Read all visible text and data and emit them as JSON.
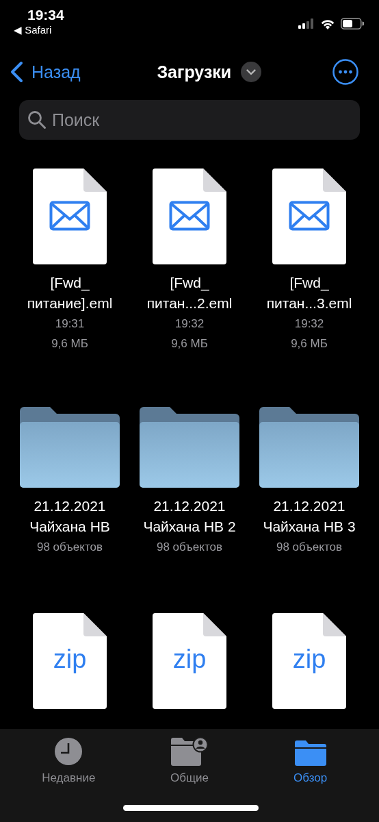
{
  "status_bar": {
    "time": "19:34",
    "back_app": "◀ Safari"
  },
  "nav": {
    "back": "Назад",
    "title": "Загрузки"
  },
  "search": {
    "placeholder": "Поиск"
  },
  "items": [
    {
      "kind": "eml",
      "name_lines": [
        "[Fwd_",
        "питание].eml"
      ],
      "details": [
        "19:31",
        "9,6 МБ"
      ]
    },
    {
      "kind": "eml",
      "name_lines": [
        "[Fwd_",
        "питан...2.eml"
      ],
      "details": [
        "19:32",
        "9,6 МБ"
      ]
    },
    {
      "kind": "eml",
      "name_lines": [
        "[Fwd_",
        "питан...3.eml"
      ],
      "details": [
        "19:32",
        "9,6 МБ"
      ]
    },
    {
      "kind": "folder",
      "name_lines": [
        "21.12.2021",
        "Чайхана НВ"
      ],
      "details": [
        "98 объектов"
      ]
    },
    {
      "kind": "folder",
      "name_lines": [
        "21.12.2021",
        "Чайхана НВ 2"
      ],
      "details": [
        "98 объектов"
      ]
    },
    {
      "kind": "folder",
      "name_lines": [
        "21.12.2021",
        "Чайхана НВ 3"
      ],
      "details": [
        "98 объектов"
      ]
    },
    {
      "kind": "zip",
      "badge": "zip"
    },
    {
      "kind": "zip",
      "badge": "zip"
    },
    {
      "kind": "zip",
      "badge": "zip"
    }
  ],
  "tabs": [
    {
      "kind": "recent",
      "label": "Недавние",
      "selected": false
    },
    {
      "kind": "shared",
      "label": "Общие",
      "selected": false
    },
    {
      "kind": "browse",
      "label": "Обзор",
      "selected": true
    }
  ]
}
